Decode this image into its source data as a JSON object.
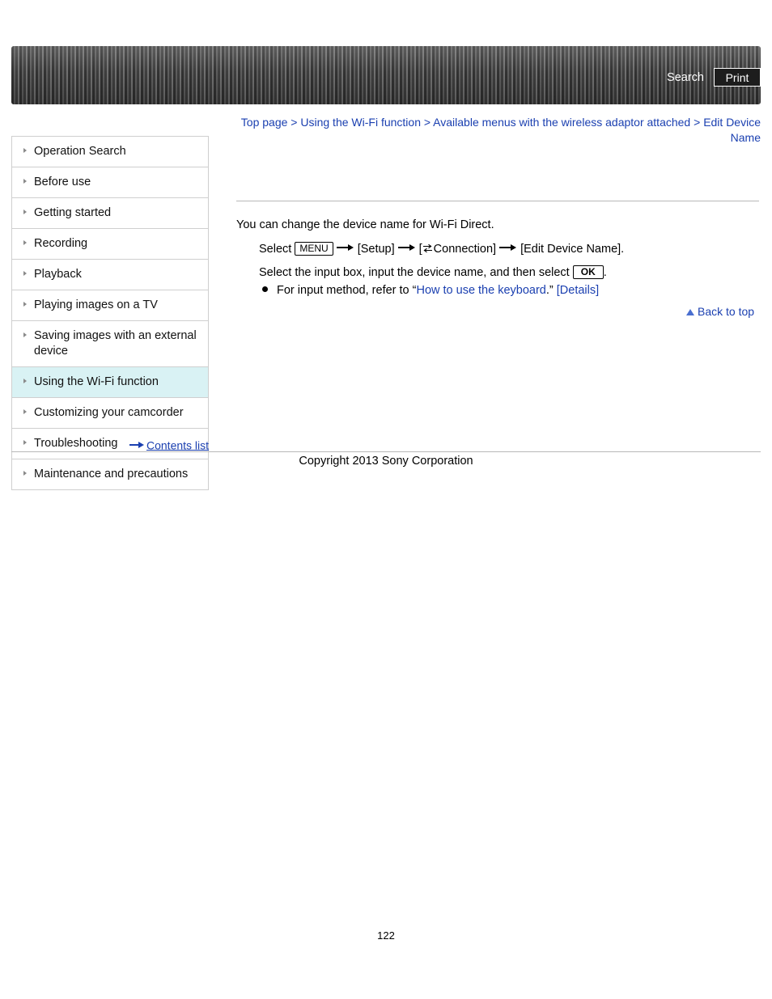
{
  "header": {
    "search_label": "Search",
    "print_label": "Print"
  },
  "breadcrumb": {
    "items": [
      "Top page",
      "Using the Wi-Fi function",
      "Available menus with the wireless adaptor attached",
      "Edit Device Name"
    ],
    "separator": ">"
  },
  "sidebar": {
    "items": [
      {
        "label": "Operation Search",
        "selected": false
      },
      {
        "label": "Before use",
        "selected": false
      },
      {
        "label": "Getting started",
        "selected": false
      },
      {
        "label": "Recording",
        "selected": false
      },
      {
        "label": "Playback",
        "selected": false
      },
      {
        "label": "Playing images on a TV",
        "selected": false
      },
      {
        "label": "Saving images with an external device",
        "selected": false
      },
      {
        "label": "Using the Wi-Fi function",
        "selected": true
      },
      {
        "label": "Customizing your camcorder",
        "selected": false
      },
      {
        "label": "Troubleshooting",
        "selected": false
      },
      {
        "label": "Maintenance and precautions",
        "selected": false
      }
    ],
    "contents_list_label": "Contents list"
  },
  "content": {
    "intro": "You can change the device name for Wi-Fi Direct.",
    "step1": {
      "select_word": "Select",
      "menu_button": "MENU",
      "setup": "[Setup]",
      "connection": "Connection]",
      "connection_prefix": "[",
      "edit_device_name": "[Edit Device Name]."
    },
    "step2": {
      "text_before": "Select the input box, input the device name, and then select",
      "ok_button": "OK",
      "text_after": "."
    },
    "bullet": {
      "text_before": "For input method, refer to “",
      "link_text": "How to use the keyboard",
      "text_mid": ".” ",
      "details_link": "[Details]"
    },
    "back_to_top": "Back to top"
  },
  "footer": {
    "copyright": "Copyright 2013 Sony Corporation",
    "page_number": "122"
  }
}
